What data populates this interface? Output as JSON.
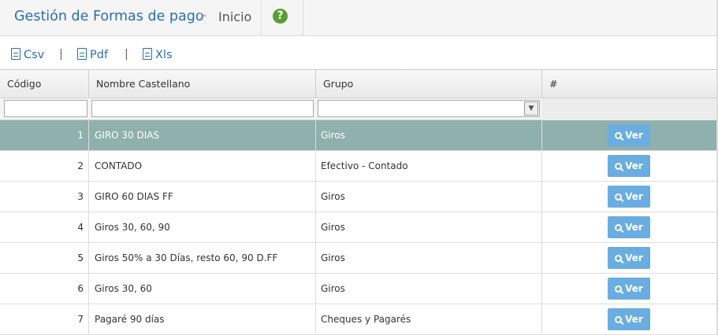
{
  "header": {
    "title": "Gestión de Formas de pago",
    "separator": ">",
    "current": "Inicio",
    "help_icon": "question-circle-icon"
  },
  "export": {
    "csv": "Csv",
    "pdf": "Pdf",
    "xls": "Xls",
    "separator": "|"
  },
  "grid": {
    "columns": [
      "Código",
      "Nombre Castellano",
      "Grupo",
      "#"
    ],
    "filters": {
      "codigo": "",
      "nombre": "",
      "grupo": ""
    },
    "action_label": "Ver",
    "selected_row": 0,
    "rows": [
      {
        "codigo": "1",
        "nombre": "GIRO 30 DIAS",
        "grupo": "Giros"
      },
      {
        "codigo": "2",
        "nombre": "CONTADO",
        "grupo": "Efectivo - Contado"
      },
      {
        "codigo": "3",
        "nombre": "GIRO 60 DIAS FF",
        "grupo": "Giros"
      },
      {
        "codigo": "4",
        "nombre": "Giros 30, 60, 90",
        "grupo": "Giros"
      },
      {
        "codigo": "5",
        "nombre": "Giros 50% a 30 Días, resto 60, 90 D.FF",
        "grupo": "Giros"
      },
      {
        "codigo": "6",
        "nombre": "Giros 30, 60",
        "grupo": "Giros"
      },
      {
        "codigo": "7",
        "nombre": "Pagaré 90 días",
        "grupo": "Cheques y Pagarés"
      }
    ]
  },
  "colors": {
    "title": "#2a6fa8",
    "selected_row": "#8fb0ad",
    "button": "#6aade0",
    "help": "#5a9d33"
  }
}
